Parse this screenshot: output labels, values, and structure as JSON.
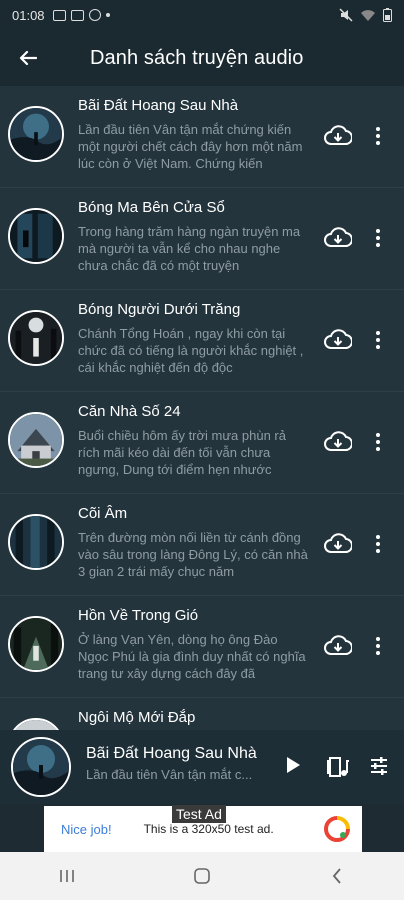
{
  "status_bar": {
    "time": "01:08"
  },
  "app_bar": {
    "title": "Danh sách truyện audio"
  },
  "stories": [
    {
      "title": "Bãi Đất Hoang Sau Nhà",
      "desc": "Lần đầu tiên Vân tận mắt chứng kiến một người chết cách đây hơn một năm lúc còn ở Việt Nam. Chứng kiến"
    },
    {
      "title": "Bóng Ma Bên Cửa Sổ",
      "desc": "Trong hàng trăm hàng ngàn truyện ma mà người ta vẫn kể cho  nhau nghe  chưa chắc đã có một truyện"
    },
    {
      "title": "Bóng Người Dưới Trăng",
      "desc": "Chánh Tổng Hoán , ngay khi còn tại chức đã có tiếng là người khắc nghiệt , cái khắc nghiệt đến độ độc"
    },
    {
      "title": "Căn Nhà Số 24",
      "desc": "Buổi chiều hôm ấy trời mưa phùn rả rích mãi kéo dài đến tối vẫn chưa ngưng, Dung tới điểm hẹn nhước"
    },
    {
      "title": "Cõi Âm",
      "desc": "Trên đường mòn nối liền từ cánh đồng vào sâu trong làng Đông Lý, có căn nhà 3 gian 2 trái mấy chục năm"
    },
    {
      "title": "Hồn Về Trong Gió",
      "desc": "Ở làng Vạn Yên, dòng họ ông Đào Ngọc Phú là gia đình duy nhất có nghĩa trang tư xây dựng cách đây đã"
    },
    {
      "title": "Ngôi Mộ Mới Đắp",
      "desc": ""
    }
  ],
  "player": {
    "title": "Bãi Đất Hoang Sau Nhà",
    "subtitle": "Lần đầu tiên Vân tận mắt c..."
  },
  "ad": {
    "label": "Test Ad",
    "nice_job": "Nice job!",
    "text": "This is a 320x50 test ad."
  }
}
